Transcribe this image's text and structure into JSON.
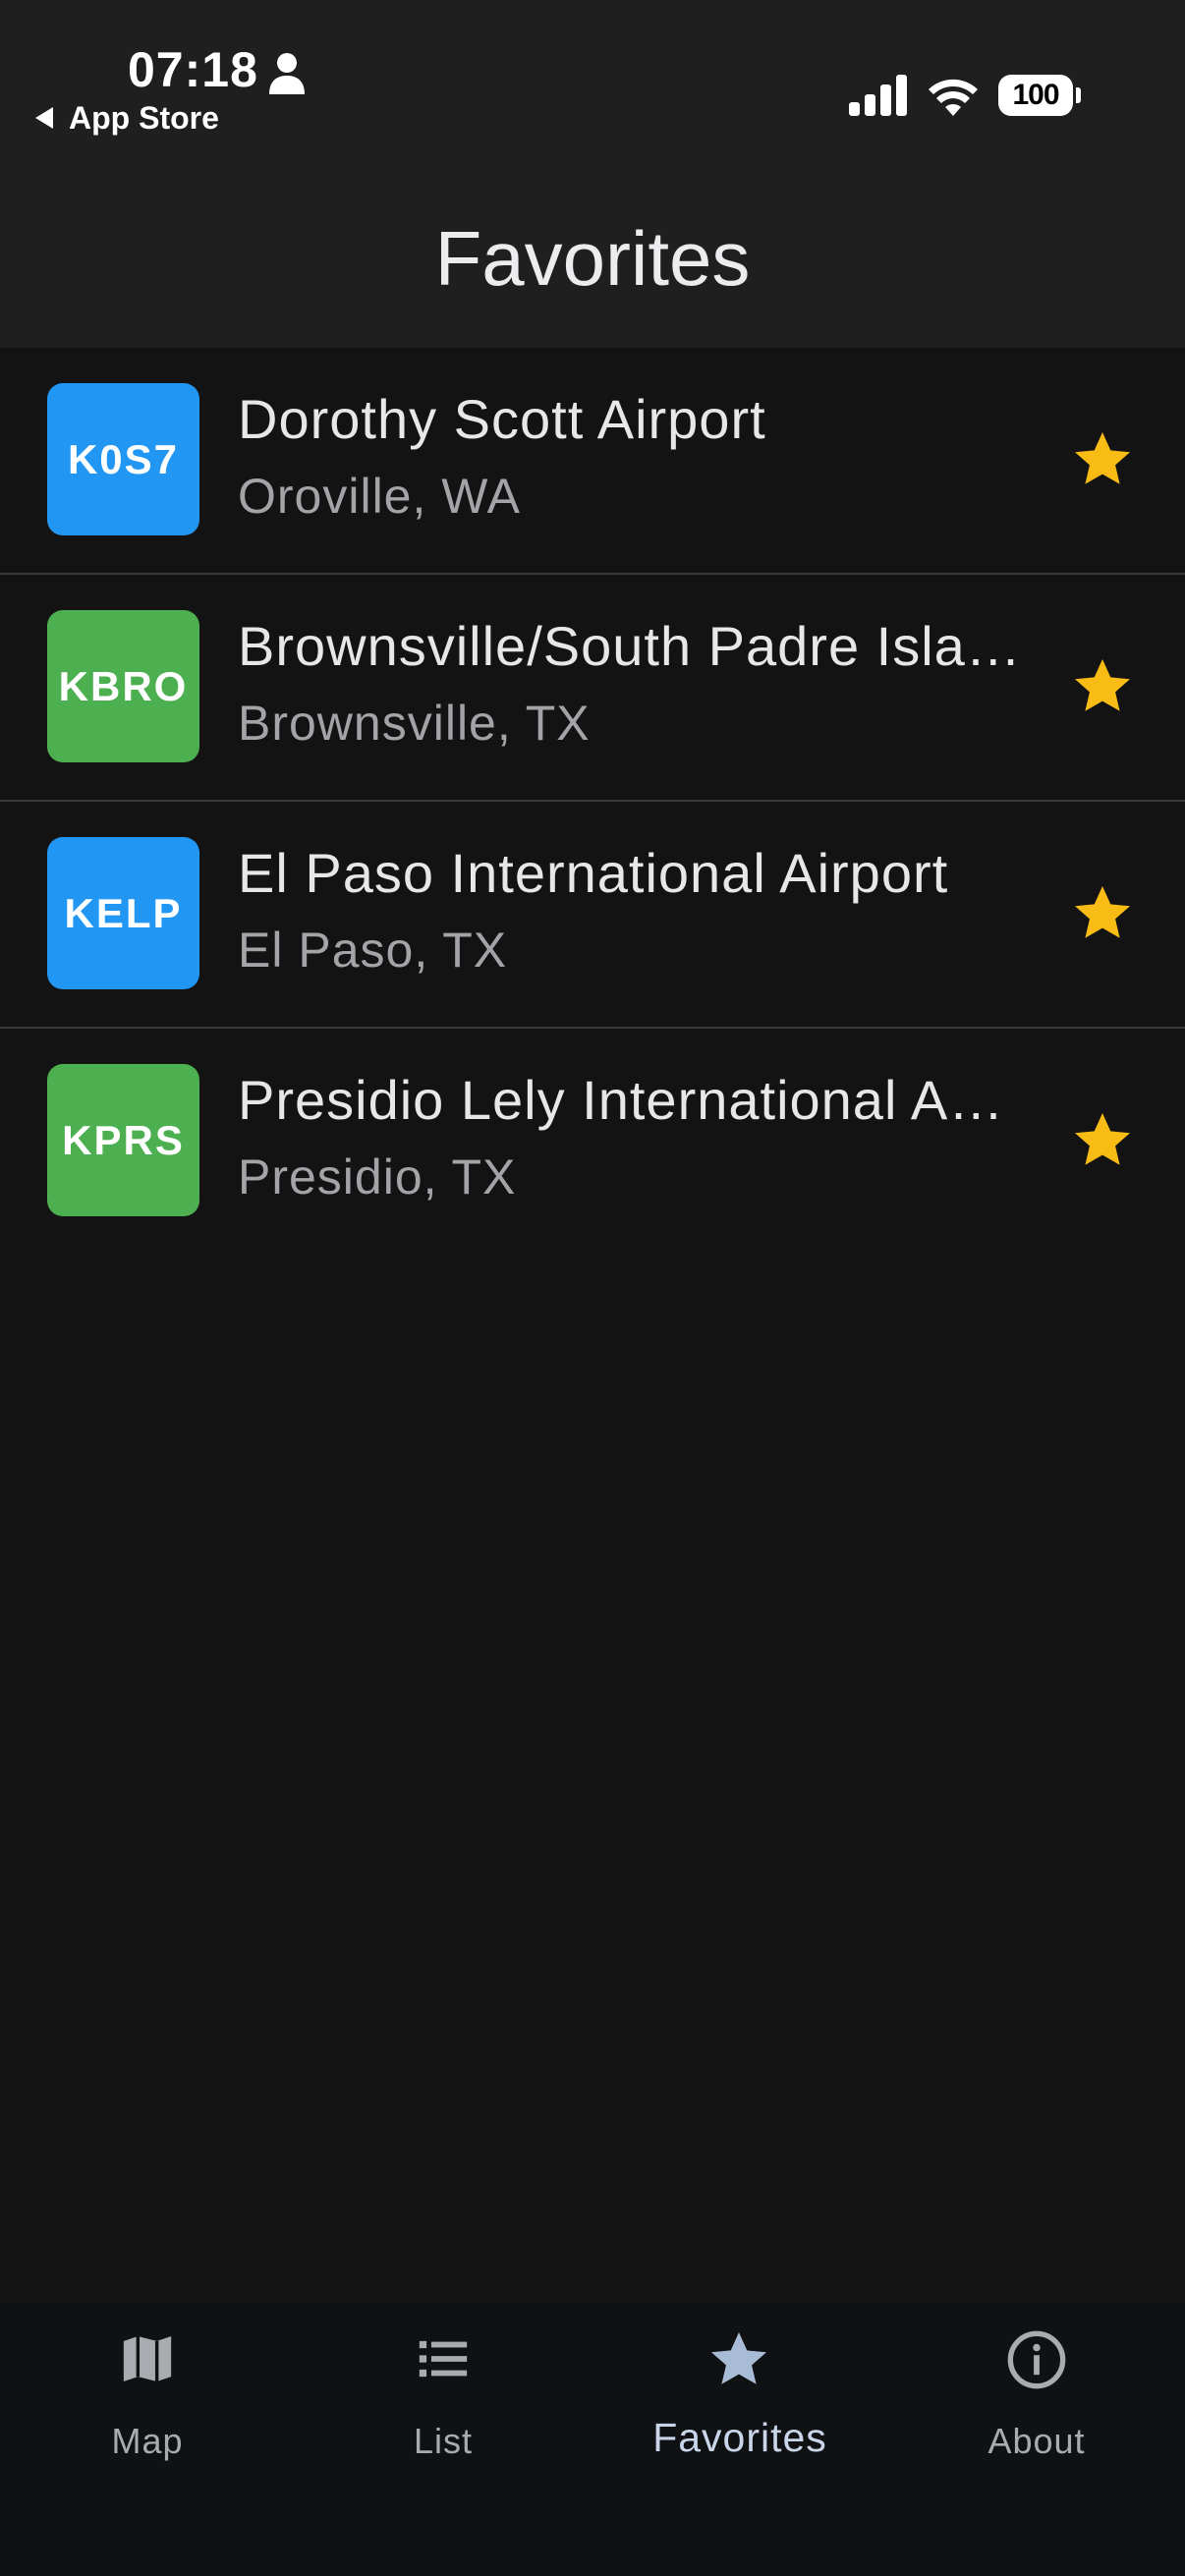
{
  "status_bar": {
    "time": "07:18",
    "back_label": "App Store",
    "battery": "100"
  },
  "header": {
    "title": "Favorites"
  },
  "favorites": [
    {
      "code": "K0S7",
      "name": "Dorothy Scott Airport",
      "location": "Oroville, WA",
      "badge_color": "#2196f3"
    },
    {
      "code": "KBRO",
      "name": "Brownsville/South Padre Isla…",
      "location": "Brownsville, TX",
      "badge_color": "#4caf50"
    },
    {
      "code": "KELP",
      "name": "El Paso International Airport",
      "location": "El Paso, TX",
      "badge_color": "#2196f3"
    },
    {
      "code": "KPRS",
      "name": "Presidio Lely International A…",
      "location": "Presidio, TX",
      "badge_color": "#4caf50"
    }
  ],
  "tabs": [
    {
      "label": "Map",
      "icon": "map-icon"
    },
    {
      "label": "List",
      "icon": "list-icon"
    },
    {
      "label": "Favorites",
      "icon": "star-icon",
      "active": true
    },
    {
      "label": "About",
      "icon": "info-icon"
    }
  ],
  "colors": {
    "star": "#f9bc15",
    "background": "#131314",
    "header": "#1f1f20",
    "tabbar": "#0f1113"
  }
}
